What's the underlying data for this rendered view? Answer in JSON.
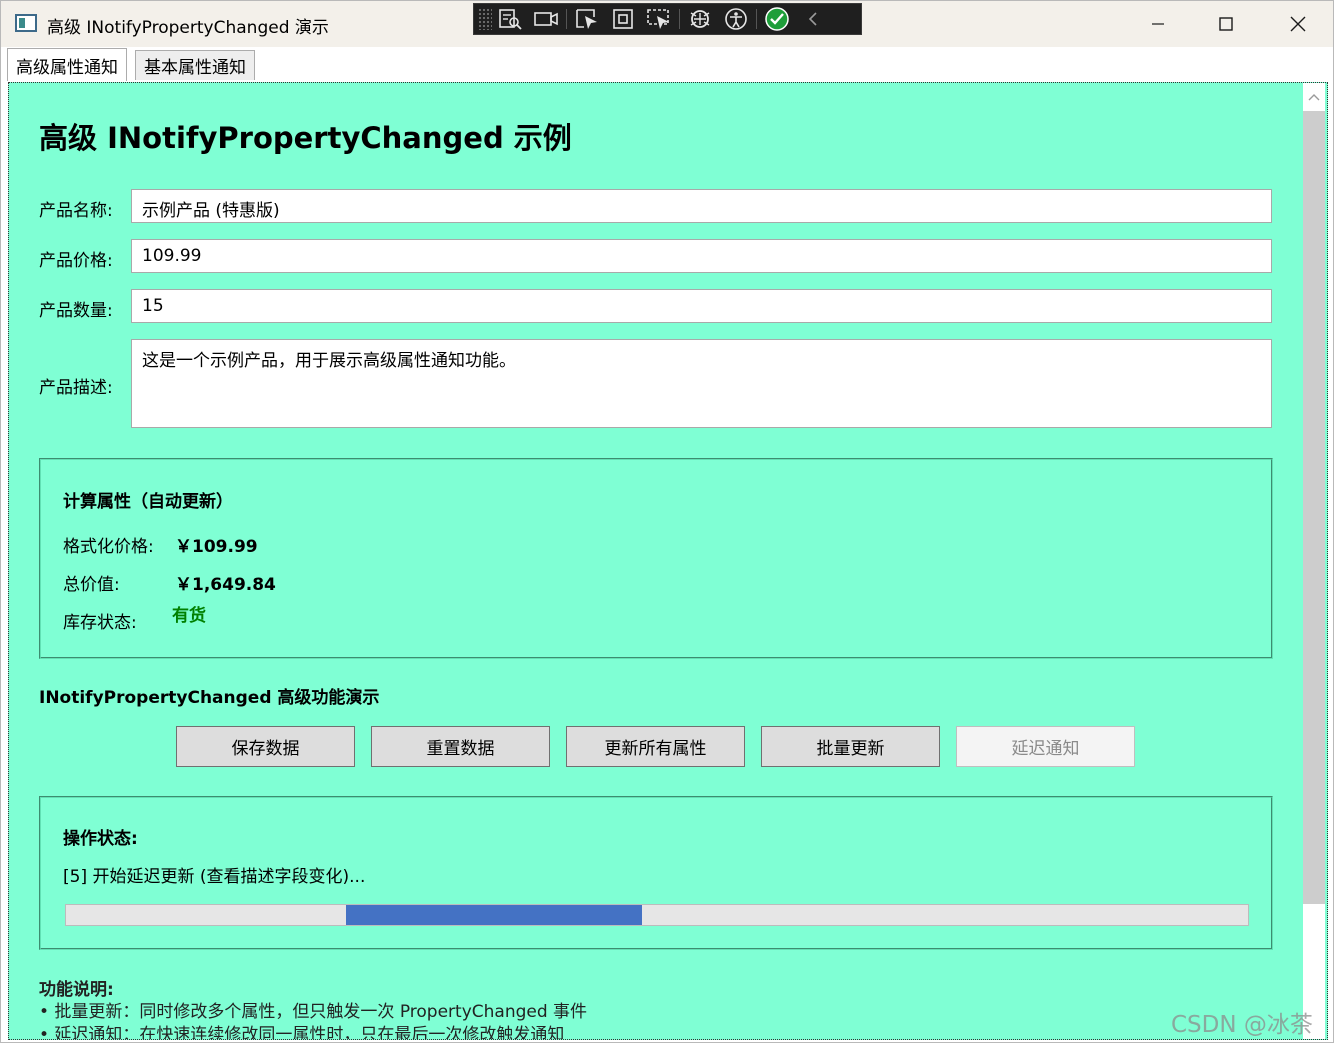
{
  "window": {
    "title": "高级 INotifyPropertyChanged 演示",
    "minimize_glyph": "—",
    "maximize_glyph": "☐",
    "close_glyph": "✕"
  },
  "debug_toolbar": {
    "icons": [
      "visual-tree-icon",
      "record-icon",
      "select-element-icon",
      "display-adorners-icon",
      "track-focus-icon",
      "binding-failures-icon",
      "accessibility-icon",
      "checked-icon",
      "collapse-icon"
    ]
  },
  "tabs": [
    {
      "label": "高级属性通知",
      "active": true
    },
    {
      "label": "基本属性通知",
      "active": false
    }
  ],
  "page": {
    "heading": "高级 INotifyPropertyChanged 示例"
  },
  "form": {
    "name_label": "产品名称:",
    "name_value": "示例产品 (特惠版)",
    "price_label": "产品价格:",
    "price_value": "109.99",
    "quantity_label": "产品数量:",
    "quantity_value": "15",
    "description_label": "产品描述:",
    "description_value": "这是一个示例产品，用于展示高级属性通知功能。"
  },
  "computed": {
    "title": "计算属性（自动更新）",
    "formatted_price_label": "格式化价格:",
    "formatted_price_value": "￥109.99",
    "total_label": "总价值:",
    "total_value": "￥1,649.84",
    "stock_label": "库存状态:",
    "stock_value": "有货",
    "stock_color": "#008000"
  },
  "actions": {
    "section_title": "INotifyPropertyChanged 高级功能演示",
    "buttons": [
      {
        "label": "保存数据",
        "enabled": true
      },
      {
        "label": "重置数据",
        "enabled": true
      },
      {
        "label": "更新所有属性",
        "enabled": true
      },
      {
        "label": "批量更新",
        "enabled": true
      },
      {
        "label": "延迟通知",
        "enabled": false
      }
    ]
  },
  "status": {
    "title": "操作状态:",
    "message": "[5] 开始延迟更新 (查看描述字段变化)...",
    "progress_indicator": {
      "mode": "indeterminate",
      "start_fraction": 0.237,
      "end_fraction": 0.487,
      "color": "#4472c4"
    }
  },
  "notes": {
    "title": "功能说明:",
    "items": [
      "• 批量更新：同时修改多个属性，但只触发一次 PropertyChanged 事件",
      "• 延迟通知：在快速连续修改同一属性时，只在最后一次修改触发通知"
    ]
  },
  "colors": {
    "content_background": "#7fffd4",
    "accent": "#4472c4"
  },
  "watermark": "CSDN @冰茶"
}
